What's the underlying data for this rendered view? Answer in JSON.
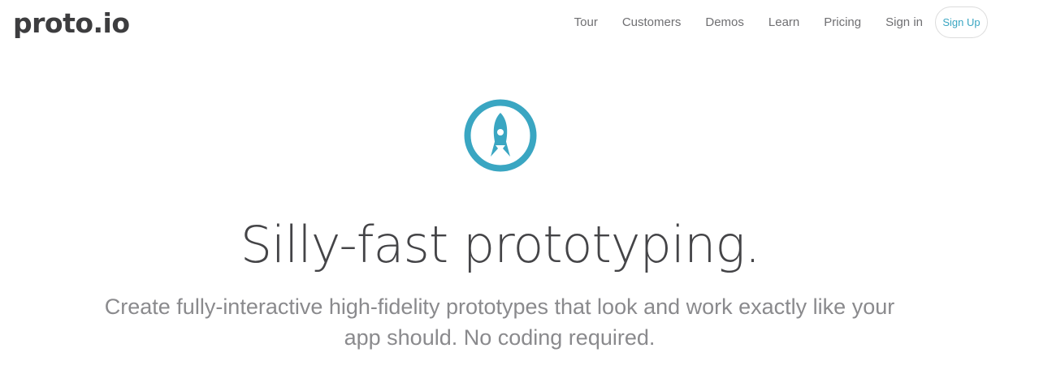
{
  "brand": {
    "logo_text": "proto.io",
    "accent_color": "#3aa6c2"
  },
  "nav": {
    "items": [
      {
        "label": "Tour"
      },
      {
        "label": "Customers"
      },
      {
        "label": "Demos"
      },
      {
        "label": "Learn"
      },
      {
        "label": "Pricing"
      },
      {
        "label": "Sign in"
      }
    ],
    "signup_label": "Sign Up"
  },
  "hero": {
    "icon": "rocket-icon",
    "title": "Silly-fast prototyping.",
    "subtitle": "Create fully-interactive high-fidelity prototypes that look and work exactly like your app should. No coding required."
  }
}
